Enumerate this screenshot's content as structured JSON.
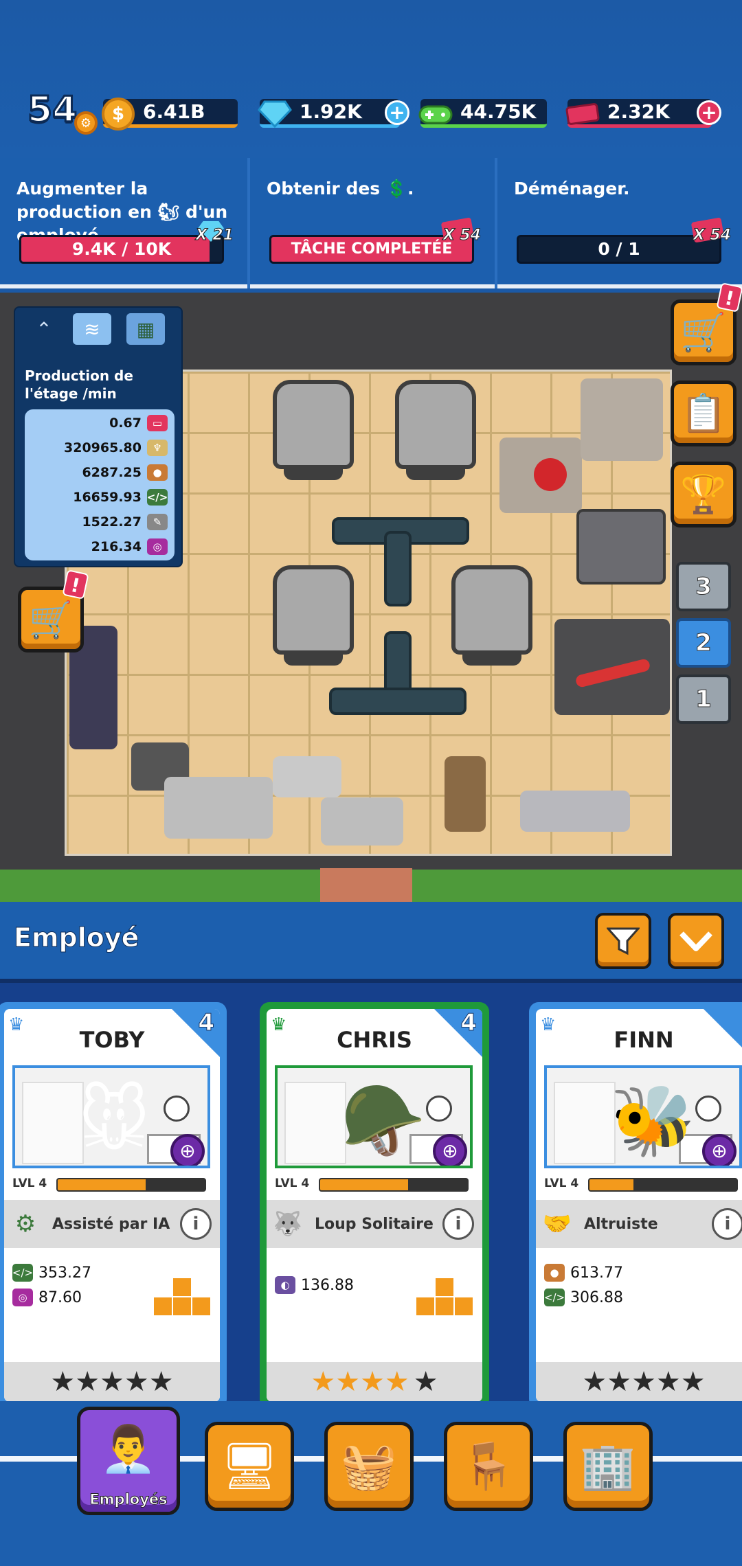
{
  "hud": {
    "level": "54",
    "coins": "6.41B",
    "gems": "1.92K",
    "controllers": "44.75K",
    "tickets": "2.32K",
    "colors": {
      "coins": "#f39a1c",
      "gems": "#3fb3f0",
      "controllers": "#5bd34a",
      "tickets": "#e2345e"
    }
  },
  "quests": [
    {
      "title": "Augmenter la production en 🐿 d'un employé.",
      "progress_text": "9.4K / 10K",
      "progress": 0.94,
      "reward": "X 21",
      "reward_icon": "gem-icon"
    },
    {
      "title": "Obtenir des 💲.",
      "progress_text": "TÂCHE COMPLETÉE",
      "progress": 1.0,
      "reward": "X 54",
      "reward_icon": "ticket-icon"
    },
    {
      "title": "Déménager.",
      "progress_text": "0 / 1",
      "progress": 0.0,
      "reward": "X 54",
      "reward_icon": "ticket-icon"
    }
  ],
  "production": {
    "title": "Production de l'étage /min",
    "rows": [
      {
        "value": "0.67",
        "icon": "ticket-icon",
        "color": "#e2345e"
      },
      {
        "value": "320965.80",
        "icon": "trophy-icon",
        "color": "#d7b86a"
      },
      {
        "value": "6287.25",
        "icon": "squirrel-icon",
        "color": "#c97a35"
      },
      {
        "value": "16659.93",
        "icon": "code-icon",
        "color": "#3c7a3c"
      },
      {
        "value": "1522.27",
        "icon": "pen-icon",
        "color": "#888888"
      },
      {
        "value": "216.34",
        "icon": "headphones-icon",
        "color": "#a62c9e"
      }
    ]
  },
  "floors": [
    "3",
    "2",
    "1"
  ],
  "active_floor": "2",
  "employees_header": {
    "title": "Employé"
  },
  "cards": [
    {
      "name": "TOBY",
      "rank": "4",
      "level": "LVL 4",
      "xp": 0.6,
      "trait": "Assisté par IA",
      "trait_icon": "chip-icon",
      "frame_color": "#3b8ee0",
      "char": "🐭",
      "stats": [
        {
          "icon": "code-icon",
          "value": "353.27",
          "color": "#3c7a3c"
        },
        {
          "icon": "headphones-icon",
          "value": "87.60",
          "color": "#a62c9e"
        }
      ],
      "stars": "★★★★★",
      "gold_stars": 0
    },
    {
      "name": "CHRIS",
      "rank": "4",
      "level": "LVL 4",
      "xp": 0.6,
      "trait": "Loup Solitaire",
      "trait_icon": "wolf-icon",
      "frame_color": "#1f9a3a",
      "char": "🪖",
      "stats": [
        {
          "icon": "guitar-pick-icon",
          "value": "136.88",
          "color": "#6a4fa0"
        }
      ],
      "stars": "★★★★★",
      "gold_stars": 4
    },
    {
      "name": "FINN",
      "rank": "4",
      "level": "LVL 4",
      "xp": 0.3,
      "trait": "Altruiste",
      "trait_icon": "handshake-icon",
      "frame_color": "#3b8ee0",
      "char": "🐝",
      "stats": [
        {
          "icon": "squirrel-icon",
          "value": "613.77",
          "color": "#c97a35"
        },
        {
          "icon": "code-icon",
          "value": "306.88",
          "color": "#3c7a3c"
        }
      ],
      "stars": "★★★★★",
      "gold_stars": 0
    }
  ],
  "nav": {
    "employees_label": "Employés"
  }
}
